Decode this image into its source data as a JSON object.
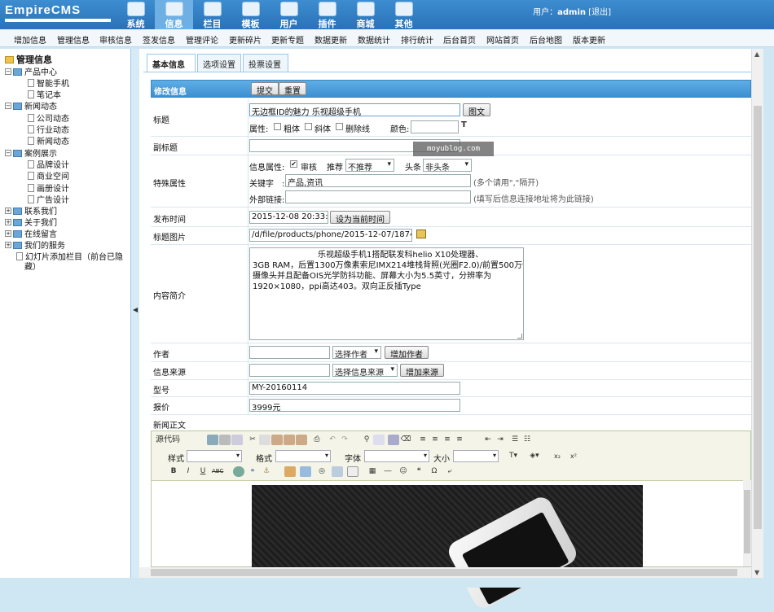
{
  "logo": "EmpireCMS",
  "topnav": [
    {
      "label": "系统",
      "icon": "globe-icon"
    },
    {
      "label": "信息",
      "icon": "edit-icon"
    },
    {
      "label": "栏目",
      "icon": "window-icon"
    },
    {
      "label": "模板",
      "icon": "template-icon"
    },
    {
      "label": "用户",
      "icon": "user-icon"
    },
    {
      "label": "插件",
      "icon": "plugin-icon"
    },
    {
      "label": "商城",
      "icon": "shop-icon"
    },
    {
      "label": "其他",
      "icon": "gear-icon"
    }
  ],
  "user": {
    "prefix": "用户：",
    "name": "admin",
    "logout": "[退出]"
  },
  "subnav": [
    "增加信息",
    "管理信息",
    "审核信息",
    "签发信息",
    "管理评论",
    "更新碎片",
    "更新专题",
    "数据更新",
    "数据统计",
    "排行统计",
    "后台首页",
    "网站首页",
    "后台地图",
    "版本更新"
  ],
  "tree": {
    "root": "管理信息",
    "nodes": [
      {
        "label": "产品中心",
        "type": "folder-open"
      },
      {
        "label": "智能手机",
        "type": "doc"
      },
      {
        "label": "笔记本",
        "type": "doc"
      },
      {
        "label": "新闻动态",
        "type": "folder-open"
      },
      {
        "label": "公司动态",
        "type": "doc"
      },
      {
        "label": "行业动态",
        "type": "doc"
      },
      {
        "label": "新闻动态",
        "type": "doc"
      },
      {
        "label": "案例展示",
        "type": "folder-open"
      },
      {
        "label": "品牌设计",
        "type": "doc"
      },
      {
        "label": "商业空间",
        "type": "doc"
      },
      {
        "label": "画册设计",
        "type": "doc"
      },
      {
        "label": "广告设计",
        "type": "doc"
      },
      {
        "label": "联系我们",
        "type": "folder"
      },
      {
        "label": "关于我们",
        "type": "folder"
      },
      {
        "label": "在线留言",
        "type": "folder"
      },
      {
        "label": "我们的服务",
        "type": "folder"
      },
      {
        "label": "幻灯片添加栏目（前台已隐",
        "type": "doc"
      },
      {
        "label": "藏）",
        "type": "cont"
      }
    ]
  },
  "tabs": [
    "基本信息",
    "选项设置",
    "投票设置"
  ],
  "form": {
    "header": "修改信息",
    "submit": "提交",
    "reset": "重置",
    "title_label": "标题",
    "title_value": "无边框ID的魅力 乐视超级手机",
    "image_btn": "图文",
    "attr_label": "属性:",
    "bold": "粗体",
    "italic": "斜体",
    "strike": "删除线",
    "color_label": "颜色:",
    "subtitle_label": "副标题",
    "special_label": "特殊属性",
    "info_attr": "信息属性:",
    "audit": "审核",
    "recommend": "推荐",
    "recommend_val": "不推荐",
    "headline": "头条",
    "headline_val": "非头条",
    "keyword_label": "关键字",
    "keyword_value": "产品,资讯",
    "keyword_hint": "(多个请用\",\"隔开)",
    "link_label": "外部链接:",
    "link_hint": "(填写后信息连接地址将为此链接)",
    "pubtime_label": "发布时间",
    "pubtime_value": "2015-12-08 20:33:22",
    "settime_btn": "设为当前时间",
    "titlepic_label": "标题图片",
    "titlepic_value": "/d/file/products/phone/2015-12-07/1874fd1",
    "summary_label": "内容简介",
    "summary_lines": [
      "　　　　　　　　乐视超级手机1搭配联发科helio X10处理器、",
      "3GB RAM，后置1300万像素索尼IMX214堆栈背照(光圈F2.0)/前置500万像素",
      "摄像头并且配备OIS光学防抖功能、屏幕大小为5.5英寸，分辨率为",
      "1920×1080，ppi高达403。双向正反插Type"
    ],
    "author_label": "作者",
    "author_select": "选择作者",
    "author_add": "增加作者",
    "source_label": "信息来源",
    "source_select": "选择信息来源",
    "source_add": "增加来源",
    "model_label": "型号",
    "model_value": "MY-20160114",
    "price_label": "报价",
    "price_value": "3999元",
    "body_label": "新闻正文"
  },
  "editor": {
    "source": "源代码",
    "style": "样式",
    "format": "格式",
    "font": "字体",
    "size": "大小"
  },
  "watermark": "moyublog.com"
}
